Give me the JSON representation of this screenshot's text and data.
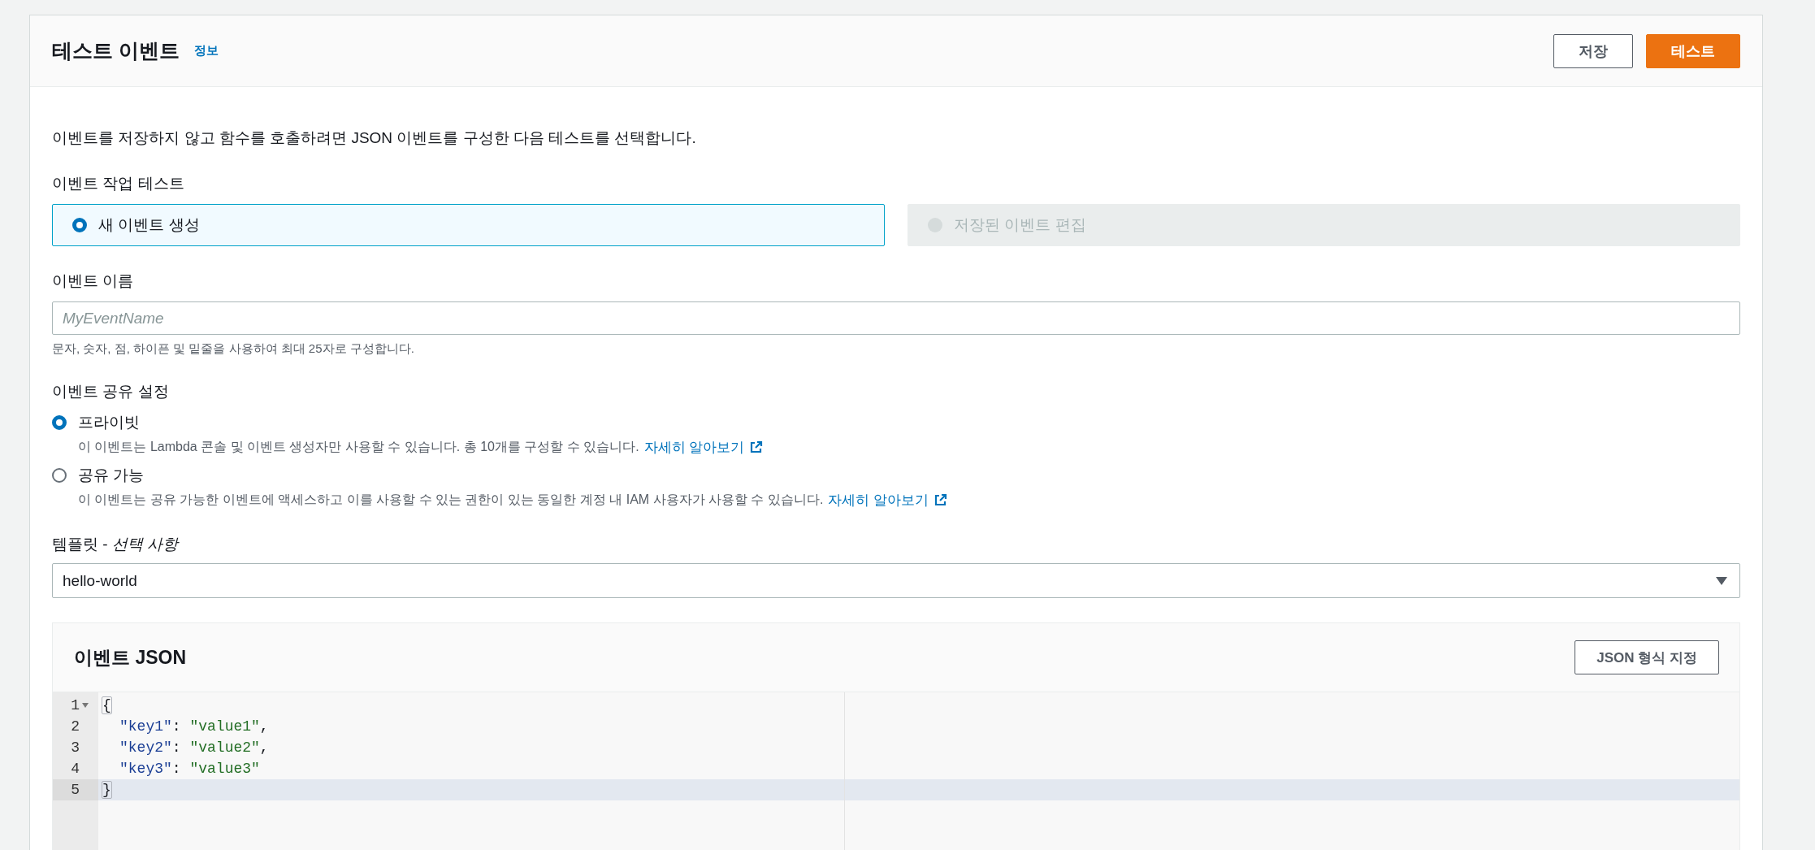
{
  "header": {
    "title": "테스트 이벤트",
    "info_link": "정보",
    "buttons": [
      {
        "label": "저장",
        "kind": "secondary"
      },
      {
        "label": "테스트",
        "kind": "primary"
      }
    ]
  },
  "description": "이벤트를 저장하지 않고 함수를 호출하려면 JSON 이벤트를 구성한 다음 테스트를 선택합니다.",
  "test_action": {
    "label": "이벤트 작업 테스트",
    "options": [
      {
        "label": "새 이벤트 생성",
        "selected": true,
        "disabled": false
      },
      {
        "label": "저장된 이벤트 편집",
        "selected": false,
        "disabled": true
      }
    ]
  },
  "event_name": {
    "label": "이벤트 이름",
    "placeholder": "MyEventName",
    "hint": "문자, 숫자, 점, 하이픈 및 밑줄을 사용하여 최대 25자로 구성합니다."
  },
  "sharing": {
    "label": "이벤트 공유 설정",
    "options": [
      {
        "label": "프라이빗",
        "selected": true,
        "description": "이 이벤트는 Lambda 콘솔 및 이벤트 생성자만 사용할 수 있습니다. 총 10개를 구성할 수 있습니다.",
        "link": "자세히 알아보기"
      },
      {
        "label": "공유 가능",
        "selected": false,
        "description": "이 이벤트는 공유 가능한 이벤트에 액세스하고 이를 사용할 수 있는 권한이 있는 동일한 계정 내 IAM 사용자가 사용할 수 있습니다.",
        "link": "자세히 알아보기"
      }
    ]
  },
  "template": {
    "label": "템플릿 - *선택 사항*",
    "value": "hello-world"
  },
  "editor": {
    "title": "이벤트 JSON",
    "format_button": "JSON 형식 지정",
    "lines": [
      {
        "number": "1",
        "foldable": true,
        "active": false,
        "indented": false,
        "tokens": [
          {
            "kind": "bracket",
            "text": "{"
          }
        ]
      },
      {
        "number": "2",
        "foldable": false,
        "active": false,
        "indented": true,
        "tokens": [
          {
            "kind": "key",
            "text": "\"key1\""
          },
          {
            "kind": "plain",
            "text": ": "
          },
          {
            "kind": "string",
            "text": "\"value1\""
          },
          {
            "kind": "plain",
            "text": ","
          }
        ]
      },
      {
        "number": "3",
        "foldable": false,
        "active": false,
        "indented": true,
        "tokens": [
          {
            "kind": "key",
            "text": "\"key2\""
          },
          {
            "kind": "plain",
            "text": ": "
          },
          {
            "kind": "string",
            "text": "\"value2\""
          },
          {
            "kind": "plain",
            "text": ","
          }
        ]
      },
      {
        "number": "4",
        "foldable": false,
        "active": false,
        "indented": true,
        "tokens": [
          {
            "kind": "key",
            "text": "\"key3\""
          },
          {
            "kind": "plain",
            "text": ": "
          },
          {
            "kind": "string",
            "text": "\"value3\""
          }
        ]
      },
      {
        "number": "5",
        "foldable": false,
        "active": true,
        "indented": false,
        "tokens": [
          {
            "kind": "bracket",
            "text": "}"
          }
        ]
      }
    ]
  }
}
